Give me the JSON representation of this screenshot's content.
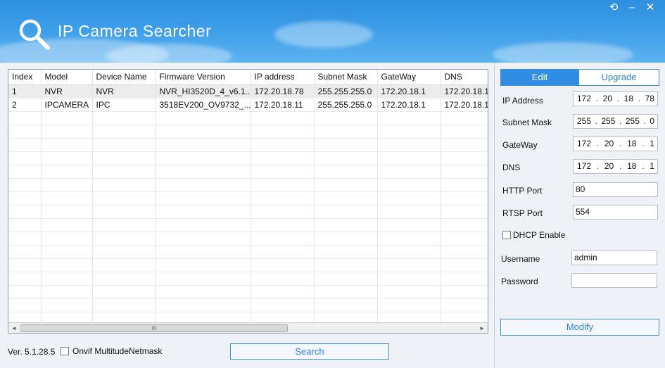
{
  "window": {
    "title": "IP Camera Searcher",
    "controls": {
      "restore": "⟲",
      "minimize": "–",
      "close": "✕"
    }
  },
  "grid": {
    "columns": [
      "Index",
      "Model",
      "Device Name",
      "Firmware Version",
      "IP address",
      "Subnet Mask",
      "GateWay",
      "DNS"
    ],
    "rows": [
      [
        "1",
        "NVR",
        "NVR",
        "NVR_HI3520D_4_v6.1....",
        "172.20.18.78",
        "255.255.255.0",
        "172.20.18.1",
        "172.20.18.1"
      ],
      [
        "2",
        "IPCAMERA",
        "IPC",
        "3518EV200_OV9732_...",
        "172.20.18.11",
        "255.255.255.0",
        "172.20.18.1",
        "172.20.18.1"
      ]
    ],
    "scroll_thumb": "III",
    "scroll_left": "◄",
    "scroll_right": "►"
  },
  "footer": {
    "version": "Ver. 5.1.28.5",
    "onvif_label": "Onvif MultitudeNetmask",
    "search_label": "Search"
  },
  "panel": {
    "tabs": {
      "edit": "Edit",
      "upgrade": "Upgrade"
    },
    "ip_address": {
      "label": "IP Address",
      "octets": [
        "172",
        "20",
        "18",
        "78"
      ]
    },
    "subnet_mask": {
      "label": "Subnet Mask",
      "octets": [
        "255",
        "255",
        "255",
        "0"
      ]
    },
    "gateway": {
      "label": "GateWay",
      "octets": [
        "172",
        "20",
        "18",
        "1"
      ]
    },
    "dns": {
      "label": "DNS",
      "octets": [
        "172",
        "20",
        "18",
        "1"
      ]
    },
    "http_port": {
      "label": "HTTP Port",
      "value": "80"
    },
    "rtsp_port": {
      "label": "RTSP Port",
      "value": "554"
    },
    "dhcp_label": "DHCP Enable",
    "username": {
      "label": "Username",
      "value": "admin"
    },
    "password": {
      "label": "Password",
      "value": ""
    },
    "modify_label": "Modify"
  },
  "colors": {
    "title_bar": "#3a9be8",
    "accent": "#2f8de4"
  }
}
